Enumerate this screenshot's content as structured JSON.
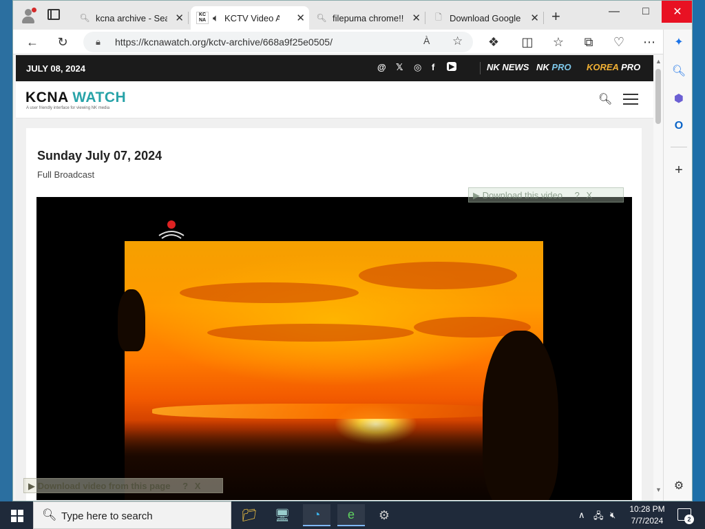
{
  "tabs": [
    {
      "title": "kcna archive - Search",
      "icon": "search-icon",
      "active": false
    },
    {
      "title": "KCTV Video Archive",
      "icon": "kcna-favicon",
      "active": true,
      "favicon_text": "KC NA",
      "audio": true
    },
    {
      "title": "filepuma chrome!!!",
      "icon": "search-icon",
      "active": false
    },
    {
      "title": "Download Google Chrome",
      "icon": "page-icon",
      "active": false
    }
  ],
  "toolbar": {
    "url": "https://kcnawatch.org/kctv-archive/668a9f25e0505/",
    "read_aloud": "À",
    "extension_badge": "1"
  },
  "site": {
    "date": "JULY 08, 2024",
    "social": [
      "@",
      "𝕏",
      "◎",
      "f",
      "▶"
    ],
    "brands": [
      {
        "label": "NK NEWS",
        "color": "#ffffff"
      },
      {
        "label": "NK PRO",
        "color": "#7ec8ea",
        "prefix": "NK",
        "suffix": "PRO"
      },
      {
        "label": "KOREA PRO",
        "color": "#f2b134",
        "prefix": "KOREA",
        "suffix": "PRO"
      }
    ],
    "logo_left": "KCNA",
    "logo_right": "WATCH",
    "tagline": "A user friendly interface for viewing NK media"
  },
  "article": {
    "title": "Sunday July 07, 2024",
    "subtitle": "Full Broadcast"
  },
  "video": {
    "download_top": "Download this video",
    "download_bottom": "Download video from this page",
    "help": "?",
    "close": "X"
  },
  "taskbar": {
    "search_placeholder": "Type here to search",
    "time": "10:28 PM",
    "date": "7/7/2024",
    "notifications": "2"
  }
}
